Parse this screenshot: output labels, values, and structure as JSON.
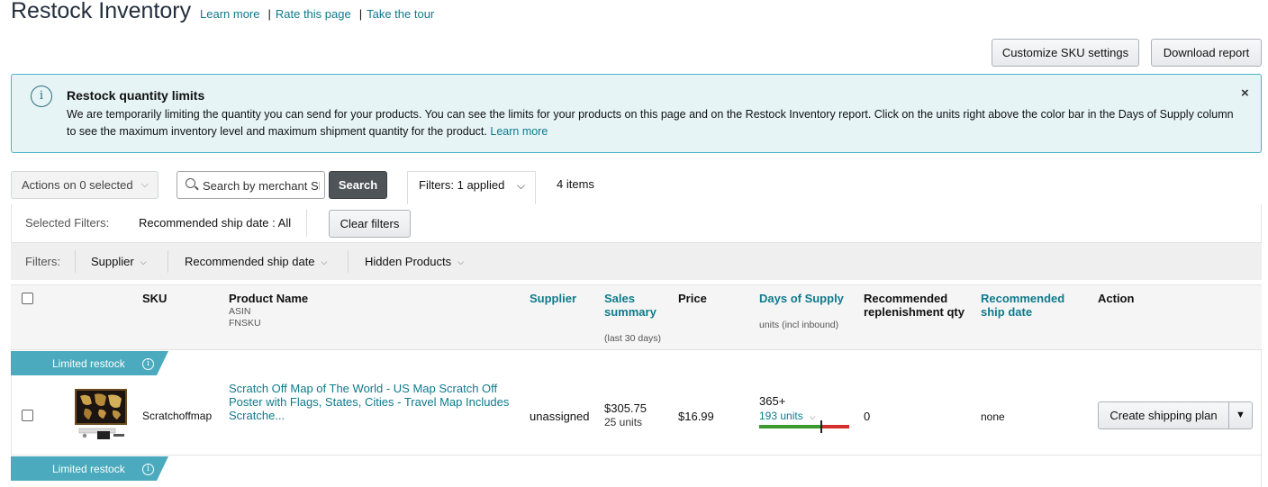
{
  "page": {
    "title": "Restock Inventory",
    "links": [
      "Learn more",
      "Rate this page",
      "Take the tour"
    ],
    "separator": "|"
  },
  "buttons": {
    "customize": "Customize SKU settings",
    "download": "Download report"
  },
  "alert": {
    "title": "Restock quantity limits",
    "text": "We are temporarily limiting the quantity you can send for your products. You can see the limits for your products on this page and on the Restock Inventory report. Click on the units right above the color bar in the Days of Supply column to see the maximum inventory level and maximum shipment quantity for the product.",
    "link": "Learn more",
    "info_icon": "i",
    "close": "×"
  },
  "toolbar": {
    "actions_label": "Actions on 0 selected",
    "search_placeholder": "Search by merchant SKU, ASIN, FNSKU",
    "search_button": "Search",
    "filters_tab": "Filters: 1 applied",
    "items_count": "4 items"
  },
  "selected_filters": {
    "label": "Selected Filters:",
    "value": "Recommended ship date : All",
    "clear_button": "Clear filters"
  },
  "filter_bar": {
    "label": "Filters:",
    "items": [
      "Supplier",
      "Recommended ship date",
      "Hidden Products"
    ]
  },
  "table": {
    "headers": {
      "sku": "SKU",
      "product_name": "Product Name",
      "product_sub1": "ASIN",
      "product_sub2": "FNSKU",
      "supplier": "Supplier",
      "sales_line1": "Sales",
      "sales_line2": "summary",
      "sales_sub": "(last 30 days)",
      "price": "Price",
      "dos": "Days of Supply",
      "dos_sub": "units (incl inbound)",
      "rec_qty_line1": "Recommended",
      "rec_qty_line2": "replenishment qty",
      "rec_date_line1": "Recommended",
      "rec_date_line2": "ship date",
      "action": "Action"
    },
    "badge": "Limited restock",
    "badge_icon": "i",
    "rows": [
      {
        "sku": "Scratchoffmap",
        "product_name": "Scratch Off Map of The World - US Map Scratch Off Poster with Flags, States, Cities - Travel Map Includes Scratche...",
        "supplier": "unassigned",
        "sales_amount": "$305.75",
        "sales_units": "25 units",
        "price": "$16.99",
        "days_of_supply": "365+",
        "units": "193 units",
        "rec_qty": "0",
        "rec_ship_date": "none",
        "action": "Create shipping plan",
        "supply_level": 0.7
      }
    ]
  },
  "colors": {
    "link": "#0F7A8C",
    "alert_bg": "#E6F4F6",
    "badge": "#4BAABD",
    "bar_green": "#3a9a2d",
    "bar_red": "#d1302b"
  }
}
